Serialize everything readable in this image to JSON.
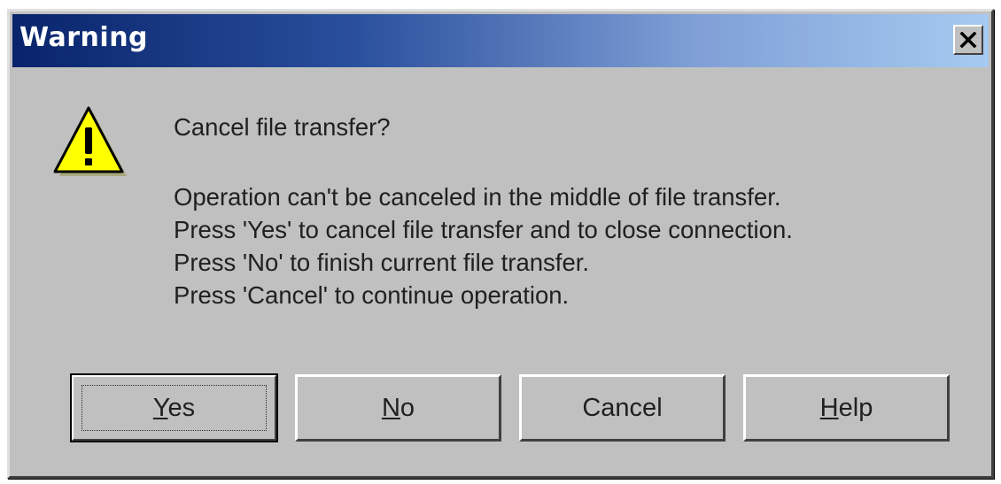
{
  "window": {
    "title": "Warning",
    "close_icon": "close-icon"
  },
  "icon": {
    "name": "warning-icon",
    "glyph": "!",
    "fill_color": "#ffff00",
    "stroke_color": "#000000"
  },
  "message": {
    "question": "Cancel file transfer?",
    "lines": [
      "Operation can't be canceled in the middle of file transfer.",
      "Press 'Yes' to cancel file transfer and to close connection.",
      "Press 'No' to finish current file transfer.",
      "Press 'Cancel' to continue operation."
    ]
  },
  "buttons": {
    "yes": {
      "mnemonic": "Y",
      "rest": "es",
      "default": true
    },
    "no": {
      "mnemonic": "N",
      "rest": "o"
    },
    "cancel": {
      "label": "Cancel"
    },
    "help": {
      "mnemonic": "H",
      "rest": "elp"
    }
  },
  "colors": {
    "titlebar_start": "#08246b",
    "titlebar_end": "#a6caf0",
    "face": "#c0c0c0"
  }
}
